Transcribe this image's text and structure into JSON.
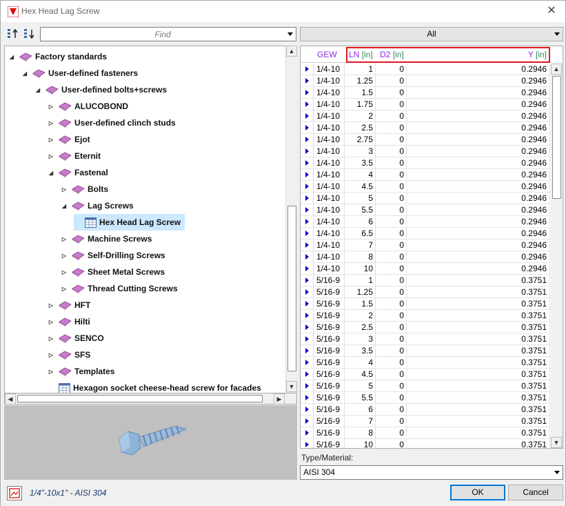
{
  "window": {
    "title": "Hex Head Lag Screw",
    "close": "✕"
  },
  "search": {
    "placeholder": "Find"
  },
  "tree": [
    {
      "label": "Factory standards",
      "level": 0,
      "state": "open",
      "icon": "book-icon"
    },
    {
      "label": "User-defined fasteners",
      "level": 1,
      "state": "open",
      "icon": "book-icon"
    },
    {
      "label": "User-defined bolts+screws",
      "level": 2,
      "state": "open",
      "icon": "book-icon"
    },
    {
      "label": "ALUCOBOND",
      "level": 3,
      "state": "closed",
      "icon": "book-icon"
    },
    {
      "label": "User-defined clinch studs",
      "level": 3,
      "state": "closed",
      "icon": "book-icon"
    },
    {
      "label": "Ejot",
      "level": 3,
      "state": "closed",
      "icon": "book-icon"
    },
    {
      "label": "Eternit",
      "level": 3,
      "state": "closed",
      "icon": "book-icon"
    },
    {
      "label": "Fastenal",
      "level": 3,
      "state": "open",
      "icon": "book-icon"
    },
    {
      "label": "Bolts",
      "level": 4,
      "state": "closed",
      "icon": "book-icon"
    },
    {
      "label": "Lag Screws",
      "level": 4,
      "state": "open",
      "icon": "book-icon"
    },
    {
      "label": "Hex Head Lag Screw",
      "level": 5,
      "state": "leaf",
      "icon": "table-icon",
      "selected": true
    },
    {
      "label": "Machine Screws",
      "level": 4,
      "state": "closed",
      "icon": "book-icon"
    },
    {
      "label": "Self-Drilling Screws",
      "level": 4,
      "state": "closed",
      "icon": "book-icon"
    },
    {
      "label": "Sheet Metal Screws",
      "level": 4,
      "state": "closed",
      "icon": "book-icon"
    },
    {
      "label": "Thread Cutting Screws",
      "level": 4,
      "state": "closed",
      "icon": "book-icon"
    },
    {
      "label": "HFT",
      "level": 3,
      "state": "closed",
      "icon": "book-icon"
    },
    {
      "label": "Hilti",
      "level": 3,
      "state": "closed",
      "icon": "book-icon"
    },
    {
      "label": "SENCO",
      "level": 3,
      "state": "closed",
      "icon": "book-icon"
    },
    {
      "label": "SFS",
      "level": 3,
      "state": "closed",
      "icon": "book-icon"
    },
    {
      "label": "Templates",
      "level": 3,
      "state": "closed",
      "icon": "book-icon"
    },
    {
      "label": "Hexagon socket cheese-head screw for facades",
      "level": 3,
      "state": "leaf",
      "icon": "table-icon"
    }
  ],
  "filter": {
    "value": "All"
  },
  "grid": {
    "columns": [
      {
        "name": "GEW",
        "unit": ""
      },
      {
        "name": "LN",
        "unit": "[in]"
      },
      {
        "name": "D2",
        "unit": "[in]"
      },
      {
        "name": "Y",
        "unit": "[in]"
      }
    ],
    "rows": [
      [
        "1/4-10",
        "1",
        "0",
        "0.2946"
      ],
      [
        "1/4-10",
        "1.25",
        "0",
        "0.2946"
      ],
      [
        "1/4-10",
        "1.5",
        "0",
        "0.2946"
      ],
      [
        "1/4-10",
        "1.75",
        "0",
        "0.2946"
      ],
      [
        "1/4-10",
        "2",
        "0",
        "0.2946"
      ],
      [
        "1/4-10",
        "2.5",
        "0",
        "0.2946"
      ],
      [
        "1/4-10",
        "2.75",
        "0",
        "0.2946"
      ],
      [
        "1/4-10",
        "3",
        "0",
        "0.2946"
      ],
      [
        "1/4-10",
        "3.5",
        "0",
        "0.2946"
      ],
      [
        "1/4-10",
        "4",
        "0",
        "0.2946"
      ],
      [
        "1/4-10",
        "4.5",
        "0",
        "0.2946"
      ],
      [
        "1/4-10",
        "5",
        "0",
        "0.2946"
      ],
      [
        "1/4-10",
        "5.5",
        "0",
        "0.2946"
      ],
      [
        "1/4-10",
        "6",
        "0",
        "0.2946"
      ],
      [
        "1/4-10",
        "6.5",
        "0",
        "0.2946"
      ],
      [
        "1/4-10",
        "7",
        "0",
        "0.2946"
      ],
      [
        "1/4-10",
        "8",
        "0",
        "0.2946"
      ],
      [
        "1/4-10",
        "10",
        "0",
        "0.2946"
      ],
      [
        "5/16-9",
        "1",
        "0",
        "0.3751"
      ],
      [
        "5/16-9",
        "1.25",
        "0",
        "0.3751"
      ],
      [
        "5/16-9",
        "1.5",
        "0",
        "0.3751"
      ],
      [
        "5/16-9",
        "2",
        "0",
        "0.3751"
      ],
      [
        "5/16-9",
        "2.5",
        "0",
        "0.3751"
      ],
      [
        "5/16-9",
        "3",
        "0",
        "0.3751"
      ],
      [
        "5/16-9",
        "3.5",
        "0",
        "0.3751"
      ],
      [
        "5/16-9",
        "4",
        "0",
        "0.3751"
      ],
      [
        "5/16-9",
        "4.5",
        "0",
        "0.3751"
      ],
      [
        "5/16-9",
        "5",
        "0",
        "0.3751"
      ],
      [
        "5/16-9",
        "5.5",
        "0",
        "0.3751"
      ],
      [
        "5/16-9",
        "6",
        "0",
        "0.3751"
      ],
      [
        "5/16-9",
        "7",
        "0",
        "0.3751"
      ],
      [
        "5/16-9",
        "8",
        "0",
        "0.3751"
      ],
      [
        "5/16-9",
        "10",
        "0",
        "0.3751"
      ]
    ]
  },
  "type_material": {
    "label": "Type/Material:",
    "value": "AISI 304"
  },
  "status": {
    "text": "1/4\"-10x1\" - AISI 304"
  },
  "buttons": {
    "ok": "OK",
    "cancel": "Cancel"
  },
  "colors": {
    "accent": "#0078d7",
    "highlight": "#e0161e",
    "column_name": "#8a2be2",
    "unit": "#2e8b57",
    "book": "#c77dc9"
  }
}
